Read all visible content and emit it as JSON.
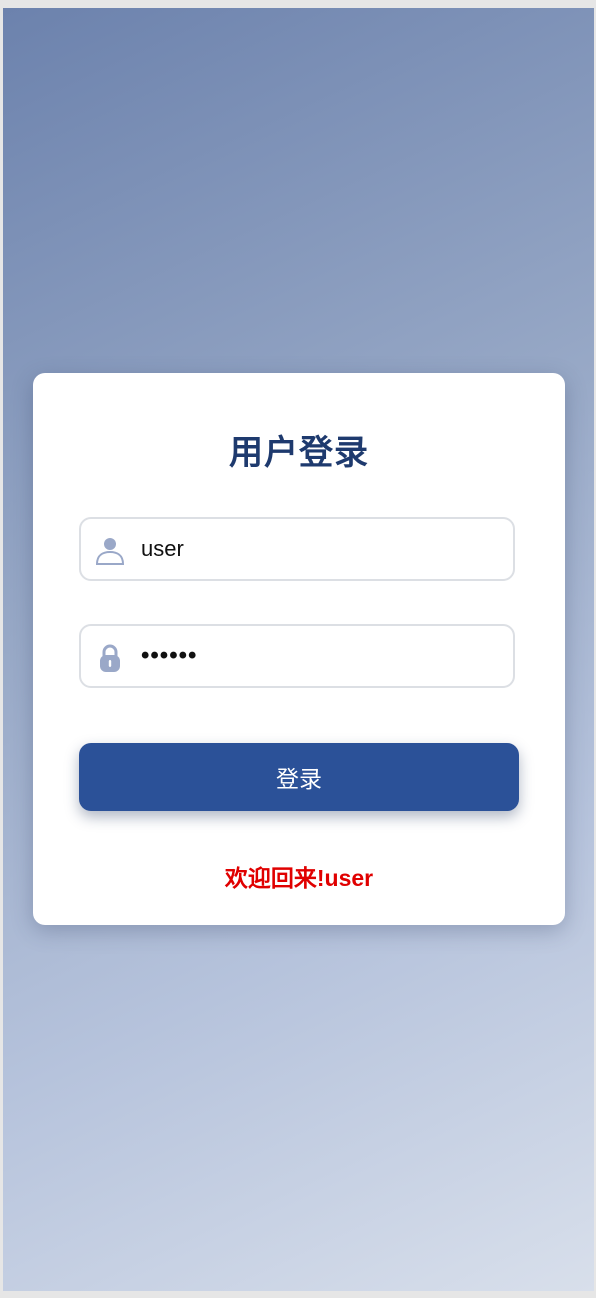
{
  "login": {
    "title": "用户登录",
    "username": {
      "value": "user",
      "icon": "user-icon"
    },
    "password": {
      "masked_value": "••••••",
      "icon": "lock-icon"
    },
    "submit_label": "登录",
    "message": "欢迎回来!user"
  },
  "colors": {
    "title": "#1e3a6e",
    "button": "#2b5198",
    "message": "#e00000",
    "icon": "#9aa8c8"
  }
}
